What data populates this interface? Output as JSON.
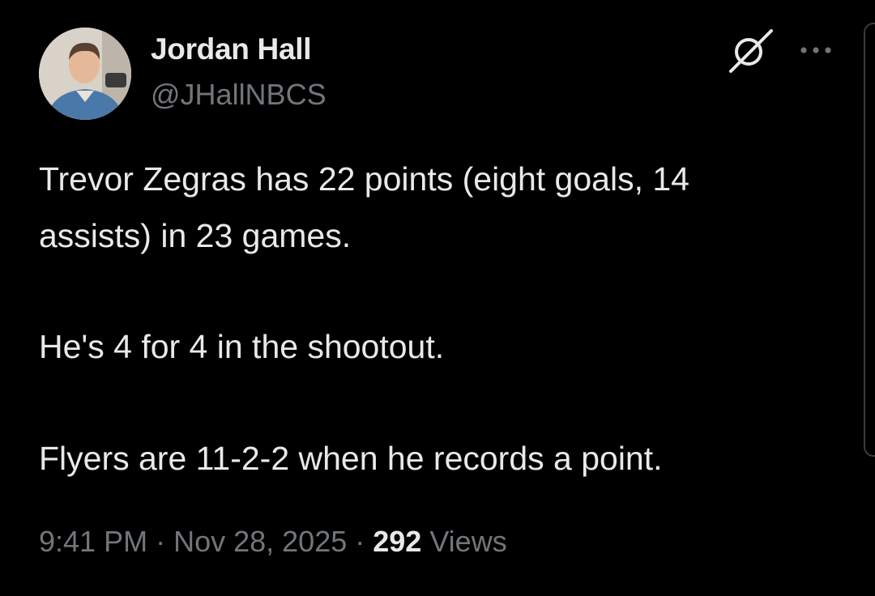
{
  "author": {
    "display_name": "Jordan Hall",
    "handle": "@JHallNBCS"
  },
  "icons": {
    "grok": "grok-icon",
    "more": "more-options-icon",
    "avatar": "avatar"
  },
  "tweet": {
    "line1": "Trevor Zegras has 22 points (eight goals, 14",
    "line2": "assists) in 23 games.",
    "line3": "He's 4 for 4 in the shootout.",
    "line4": "Flyers are 11-2-2 when he records a point."
  },
  "meta": {
    "time": "9:41 PM",
    "sep1": " · ",
    "date": "Nov 28, 2025",
    "sep2": " · ",
    "views_count": "292",
    "views_label": " Views"
  },
  "colors": {
    "background": "#000000",
    "primary_text": "#e7e9ea",
    "secondary_text": "#71767b"
  }
}
